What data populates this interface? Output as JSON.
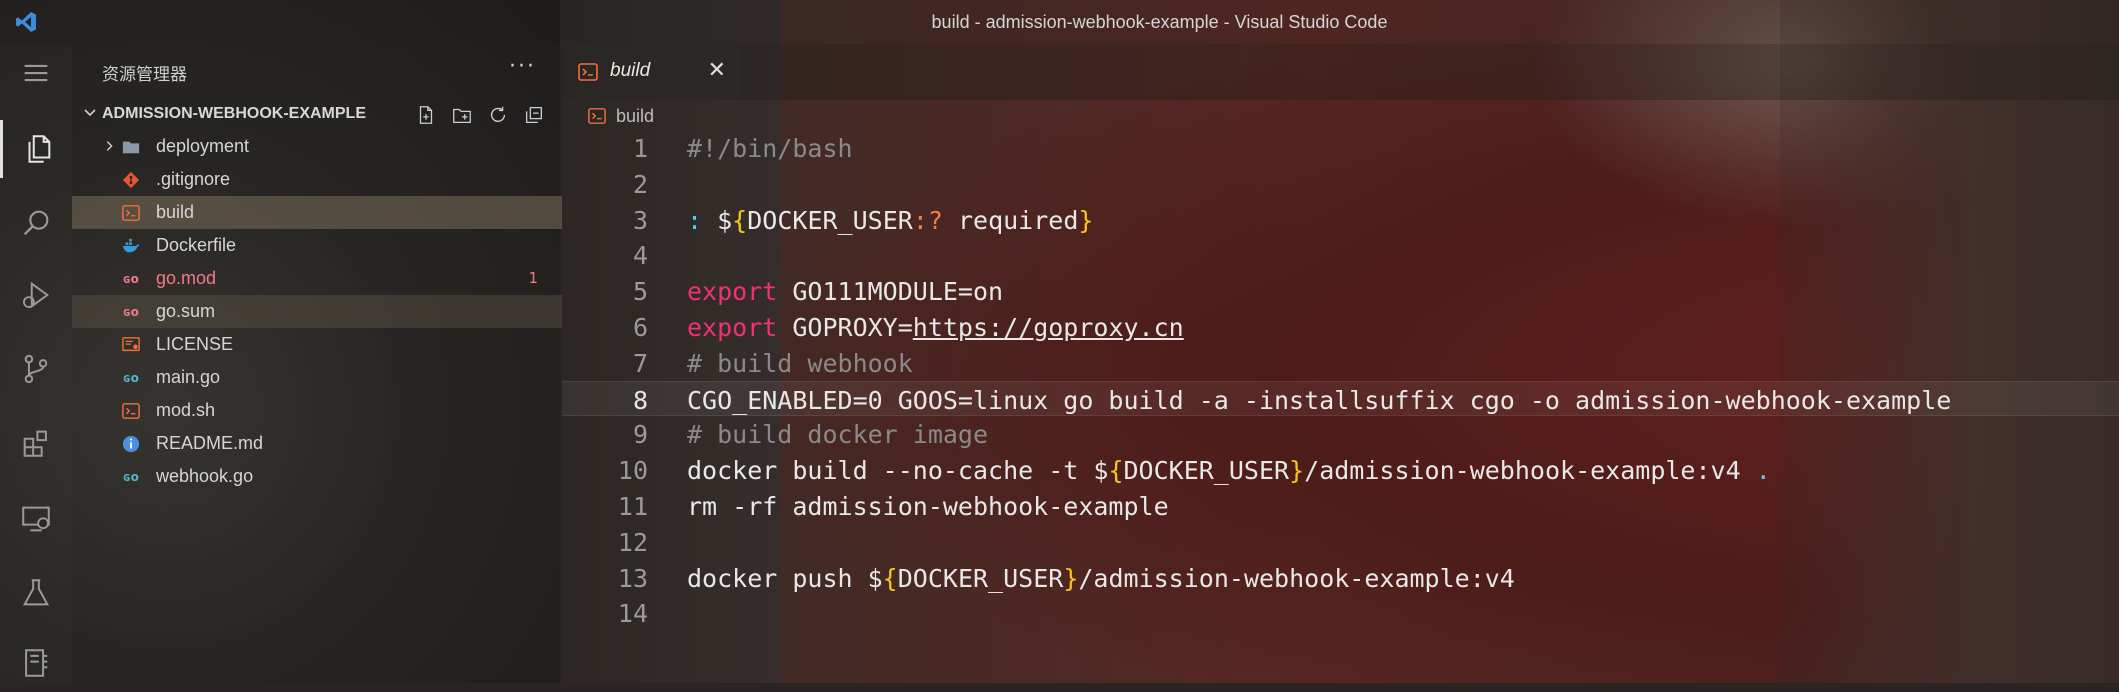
{
  "window": {
    "title": "build - admission-webhook-example - Visual Studio Code"
  },
  "activity_bar": {
    "items": [
      {
        "name": "menu-icon"
      },
      {
        "name": "explorer-icon",
        "active": true
      },
      {
        "name": "search-icon"
      },
      {
        "name": "run-debug-icon"
      },
      {
        "name": "source-control-icon"
      },
      {
        "name": "extensions-icon"
      },
      {
        "name": "remote-explorer-icon"
      },
      {
        "name": "testing-icon"
      },
      {
        "name": "notebook-icon"
      }
    ]
  },
  "sidebar": {
    "title": "资源管理器",
    "more": "···",
    "folder": "ADMISSION-WEBHOOK-EXAMPLE",
    "files": [
      {
        "label": "deployment",
        "type": "folder",
        "icon": "folder-icon"
      },
      {
        "label": ".gitignore",
        "type": "git",
        "icon": "git-icon"
      },
      {
        "label": "build",
        "type": "shell",
        "icon": "terminal-icon",
        "state": "selected"
      },
      {
        "label": "Dockerfile",
        "type": "docker",
        "icon": "docker-icon"
      },
      {
        "label": "go.mod",
        "type": "go-mod",
        "icon": "go-mod-icon",
        "error": true,
        "badge": "1"
      },
      {
        "label": "go.sum",
        "type": "go-mod",
        "icon": "go-mod-icon",
        "state": "highlighted"
      },
      {
        "label": "LICENSE",
        "type": "license",
        "icon": "license-icon"
      },
      {
        "label": "main.go",
        "type": "go",
        "icon": "go-icon"
      },
      {
        "label": "mod.sh",
        "type": "shell",
        "icon": "terminal-icon"
      },
      {
        "label": "README.md",
        "type": "info",
        "icon": "info-icon"
      },
      {
        "label": "webhook.go",
        "type": "go",
        "icon": "go-icon"
      }
    ]
  },
  "editor": {
    "tab_label": "build",
    "close_glyph": "✕",
    "breadcrumb": "build",
    "current_line": 8,
    "lines": [
      {
        "n": "1",
        "text": "#!/bin/bash"
      },
      {
        "n": "2",
        "text": ""
      },
      {
        "n": "3",
        "text": ": ${DOCKER_USER:? required}"
      },
      {
        "n": "4",
        "text": ""
      },
      {
        "n": "5",
        "text": "export GO111MODULE=on"
      },
      {
        "n": "6",
        "text": "export GOPROXY=https://goproxy.cn"
      },
      {
        "n": "7",
        "text": "# build webhook"
      },
      {
        "n": "8",
        "text": "CGO_ENABLED=0 GOOS=linux go build -a -installsuffix cgo -o admission-webhook-example"
      },
      {
        "n": "9",
        "text": "# build docker image"
      },
      {
        "n": "10",
        "text": "docker build --no-cache -t ${DOCKER_USER}/admission-webhook-example:v4 ."
      },
      {
        "n": "11",
        "text": "rm -rf admission-webhook-example"
      },
      {
        "n": "12",
        "text": ""
      },
      {
        "n": "13",
        "text": "docker push ${DOCKER_USER}/admission-webhook-example:v4"
      },
      {
        "n": "14",
        "text": ""
      }
    ]
  },
  "colors": {
    "keyword": "#f0326e",
    "comment": "#8a8a8a",
    "brace": "#f5c518",
    "operator": "#5ac8fa",
    "error": "#f07a8a",
    "accent": "#3c8dd9"
  }
}
